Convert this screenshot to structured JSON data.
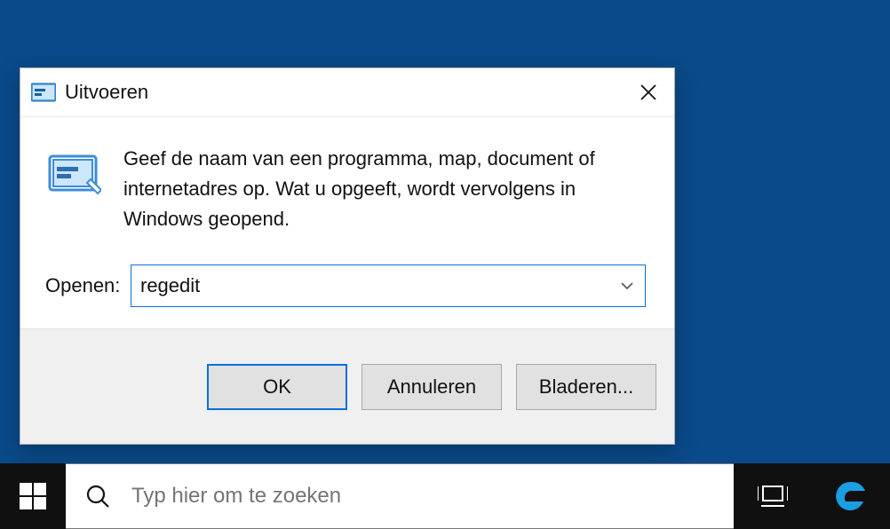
{
  "dialog": {
    "title": "Uitvoeren",
    "description": "Geef de naam van een programma, map, document of internetadres op. Wat u opgeeft, wordt vervolgens in Windows geopend.",
    "open_label": "Openen:",
    "input_value": "regedit",
    "buttons": {
      "ok": "OK",
      "cancel": "Annuleren",
      "browse": "Bladeren..."
    }
  },
  "taskbar": {
    "search_placeholder": "Typ hier om te zoeken"
  }
}
